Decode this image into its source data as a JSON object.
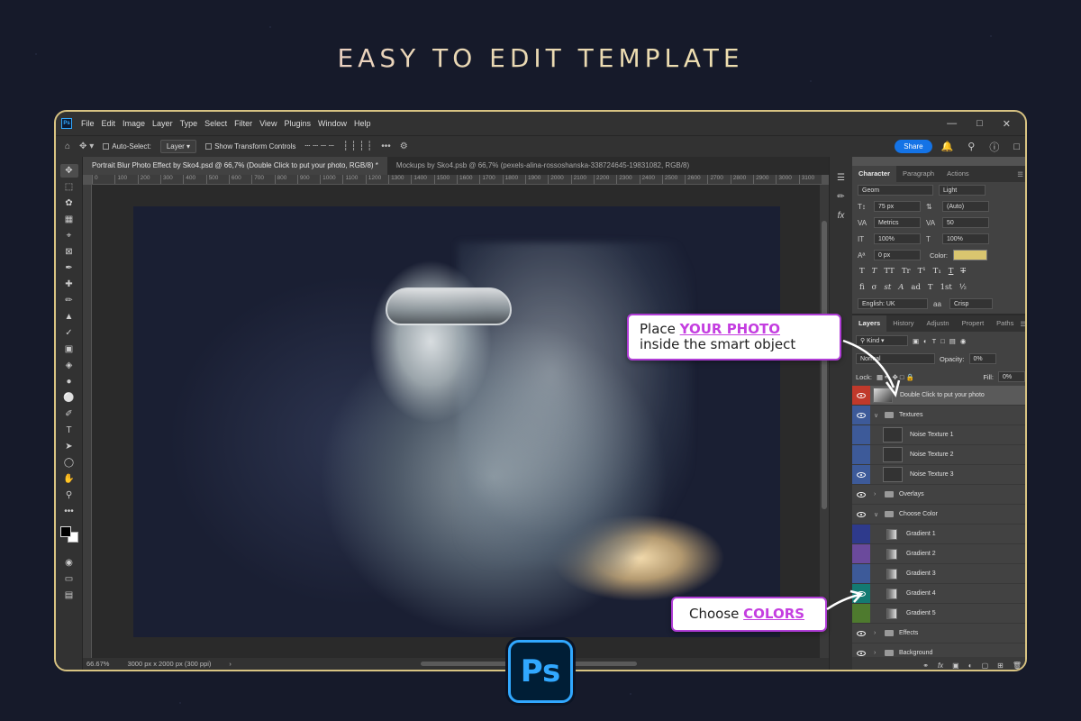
{
  "headline": "EASY TO EDIT TEMPLATE",
  "colors": {
    "accent": "#31a8ff",
    "frame": "#d8c382",
    "callout_border": "#b03cd6",
    "highlight": "#c43ee0",
    "share": "#1473e6",
    "text_color_swatch": "#d9c56f"
  },
  "menu": [
    "File",
    "Edit",
    "Image",
    "Layer",
    "Type",
    "Select",
    "Filter",
    "View",
    "Plugins",
    "Window",
    "Help"
  ],
  "options_bar": {
    "auto_select": "Auto-Select:",
    "layer_dropdown": "Layer",
    "transform_controls": "Show Transform Controls",
    "share": "Share"
  },
  "tabs": [
    "Portrait Blur Photo Effect by Sko4.psd @ 66,7% (Double Click to put your photo, RGB/8) *",
    "Mockups by Sko4.psb @ 66,7% (pexels-alina-rossoshanska-338724645-19831082, RGB/8)"
  ],
  "ruler_ticks": [
    "0",
    "100",
    "200",
    "300",
    "400",
    "500",
    "600",
    "700",
    "800",
    "900",
    "1000",
    "1100",
    "1200",
    "1300",
    "1400",
    "1500",
    "1600",
    "1700",
    "1800",
    "1900",
    "2000",
    "2100",
    "2200",
    "2300",
    "2400",
    "2500",
    "2600",
    "2700",
    "2800",
    "2900",
    "3000",
    "3100"
  ],
  "status": {
    "zoom": "66.67%",
    "doc_size": "3000 px x 2000 px (300 ppi)"
  },
  "character": {
    "tabs": [
      "Character",
      "Paragraph",
      "Actions"
    ],
    "font_family": "Geom",
    "font_style": "Light",
    "font_size": "75 px",
    "leading": "(Auto)",
    "kerning": "Metrics",
    "tracking": "50",
    "vertical_scale": "100%",
    "horizontal_scale": "100%",
    "baseline_shift": "0 px",
    "color_label": "Color:",
    "language": "English: UK",
    "antialias": "Crisp",
    "aa_label": "aa"
  },
  "layers_panel": {
    "tabs": [
      "Layers",
      "History",
      "Adjustn",
      "Propert",
      "Paths"
    ],
    "filter_kind": "Kind",
    "blend_mode": "Normal",
    "opacity_label": "Opacity:",
    "opacity_value": "0%",
    "lock_label": "Lock:",
    "fill_label": "Fill:",
    "fill_value": "0%",
    "layers": [
      {
        "name": "Double Click to put your photo",
        "color": "#c0392b",
        "kind": "smart",
        "visible": true,
        "indent": 0
      },
      {
        "name": "Textures",
        "color": "#3d5a99",
        "kind": "folder-open",
        "visible": true,
        "indent": 0
      },
      {
        "name": "Noise Texture 1",
        "color": "#3d5a99",
        "kind": "layer",
        "visible": false,
        "indent": 1
      },
      {
        "name": "Noise Texture 2",
        "color": "#3d5a99",
        "kind": "layer",
        "visible": false,
        "indent": 1
      },
      {
        "name": "Noise Texture 3",
        "color": "#3d5a99",
        "kind": "layer",
        "visible": true,
        "indent": 1
      },
      {
        "name": "Overlays",
        "color": "",
        "kind": "folder-closed",
        "visible": true,
        "indent": 0
      },
      {
        "name": "Choose Color",
        "color": "",
        "kind": "folder-open",
        "visible": true,
        "indent": 0
      },
      {
        "name": "Gradient 1",
        "color": "#2e3a8c",
        "kind": "gradient",
        "visible": false,
        "indent": 1
      },
      {
        "name": "Gradient 2",
        "color": "#6b4a9c",
        "kind": "gradient",
        "visible": false,
        "indent": 1
      },
      {
        "name": "Gradient 3",
        "color": "#3d5a99",
        "kind": "gradient",
        "visible": false,
        "indent": 1
      },
      {
        "name": "Gradient 4",
        "color": "#137a72",
        "kind": "gradient",
        "visible": true,
        "indent": 1
      },
      {
        "name": "Gradient 5",
        "color": "#4e7a2e",
        "kind": "gradient",
        "visible": false,
        "indent": 1
      },
      {
        "name": "Effects",
        "color": "",
        "kind": "folder-closed",
        "visible": true,
        "indent": 0
      },
      {
        "name": "Background",
        "color": "",
        "kind": "folder-closed",
        "visible": true,
        "indent": 0
      }
    ]
  },
  "callouts": {
    "photo_prefix": "Place ",
    "photo_highlight": "YOUR PHOTO",
    "photo_suffix": "inside the smart object",
    "colors_prefix": "Choose ",
    "colors_highlight": "COLORS"
  },
  "logo": "Ps"
}
